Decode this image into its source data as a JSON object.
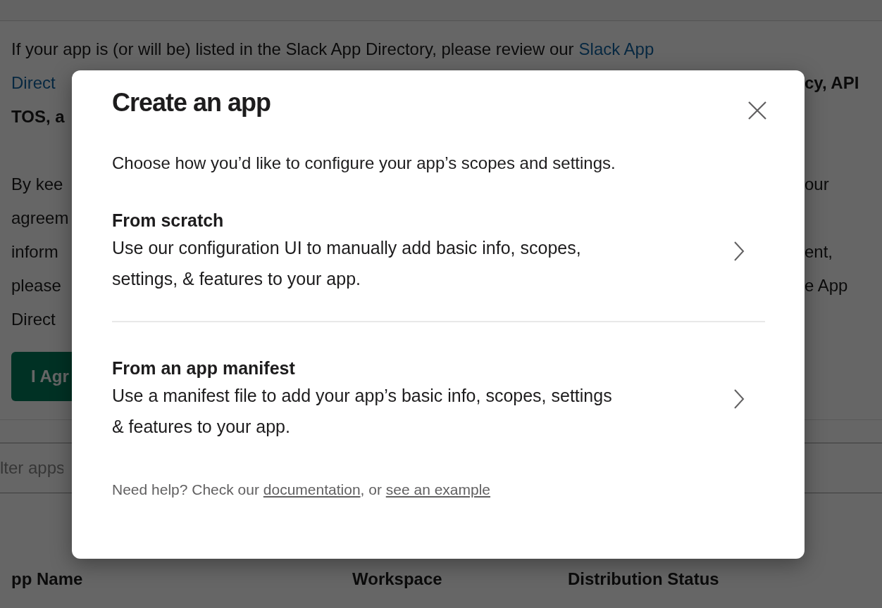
{
  "background": {
    "notice_rows": [
      {
        "left": [
          {
            "text": "If your app is (or will be) listed in the Slack App Directory, please review our",
            "kind": "plain"
          },
          {
            "text": "Slack App",
            "kind": "link"
          }
        ]
      },
      {
        "left": [
          {
            "text": "Direct",
            "kind": "link"
          }
        ],
        "right": [
          {
            "text": "cy, API",
            "kind": "bold"
          }
        ]
      },
      {
        "left": [
          {
            "text": "TOS, a",
            "kind": "bold"
          }
        ]
      }
    ],
    "agreement_rows": [
      {
        "left": [
          {
            "text": "By kee",
            "kind": "plain"
          }
        ],
        "right": [
          {
            "text": "our",
            "kind": "plain"
          }
        ]
      },
      {
        "left": [
          {
            "text": "agreem",
            "kind": "plain"
          }
        ]
      },
      {
        "left": [
          {
            "text": "inform",
            "kind": "plain"
          }
        ],
        "right": [
          {
            "text": "ent,",
            "kind": "plain"
          }
        ]
      },
      {
        "left": [
          {
            "text": "please",
            "kind": "plain"
          }
        ],
        "right": [
          {
            "text": "e App",
            "kind": "plain"
          }
        ]
      },
      {
        "left": [
          {
            "text": "Direct",
            "kind": "plain"
          }
        ]
      }
    ],
    "agree_button": "I Agr",
    "filter": {
      "placeholder": "lter apps"
    },
    "table": {
      "columns": [
        "pp Name",
        "Workspace",
        "Distribution Status"
      ]
    }
  },
  "modal": {
    "title": "Create an app",
    "description": "Choose how you’d like to configure your app’s scopes and settings.",
    "options": [
      {
        "title": "From scratch",
        "description": "Use our configuration UI to manually add basic info, scopes, settings, & features to your app."
      },
      {
        "title": "From an app manifest",
        "description": "Use a manifest file to add your app’s basic info, scopes, settings & features to your app."
      }
    ],
    "help": [
      {
        "text": "Need help? Check our ",
        "kind": "plain"
      },
      {
        "text": "documentation",
        "kind": "link"
      },
      {
        "text": ", or ",
        "kind": "plain"
      },
      {
        "text": "see an example",
        "kind": "link"
      }
    ]
  }
}
